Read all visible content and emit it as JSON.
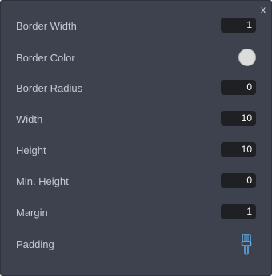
{
  "panel": {
    "close_label": "x",
    "rows": [
      {
        "label": "Border Width",
        "value": "1"
      },
      {
        "label": "Border Color",
        "color": "#dcdcdc"
      },
      {
        "label": "Border Radius",
        "value": "0"
      },
      {
        "label": "Width",
        "value": "10"
      },
      {
        "label": "Height",
        "value": "10"
      },
      {
        "label": "Min. Height",
        "value": "0"
      },
      {
        "label": "Margin",
        "value": "1"
      },
      {
        "label": "Padding",
        "icon": "paintbrush-icon"
      }
    ]
  }
}
